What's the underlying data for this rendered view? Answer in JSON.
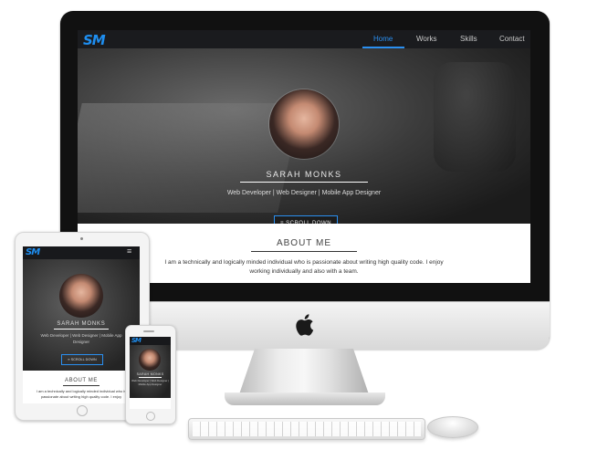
{
  "brand": {
    "logo_text": "SM",
    "accent_color": "#2a8ff0"
  },
  "desktop": {
    "nav": {
      "items": [
        "Home",
        "Works",
        "Skills",
        "Contact"
      ],
      "active": "Home"
    },
    "hero": {
      "name": "SARAH MONKS",
      "subtitle": "Web Developer | Web Designer | Mobile App Designer",
      "scroll_button": "≡ SCROLL DOWN"
    },
    "about": {
      "title": "ABOUT ME",
      "text": "I am a technically and logically minded individual who is passionate about writing high quality code. I enjoy working individually and also with a team."
    }
  },
  "tablet": {
    "menu_icon": "≡",
    "name": "SARAH MONKS",
    "subtitle": "Web Developer | Web Designer | Mobile App Designer",
    "scroll_button": "≡ SCROLL DOWN",
    "about_title": "ABOUT ME",
    "about_text": "I am a technically and logically minded individual who is passionate about writing high quality code. I enjoy"
  },
  "phone": {
    "name": "SARAH MONKS",
    "subtitle": "Web Developer | Web Designer | Mobile App Designer"
  }
}
